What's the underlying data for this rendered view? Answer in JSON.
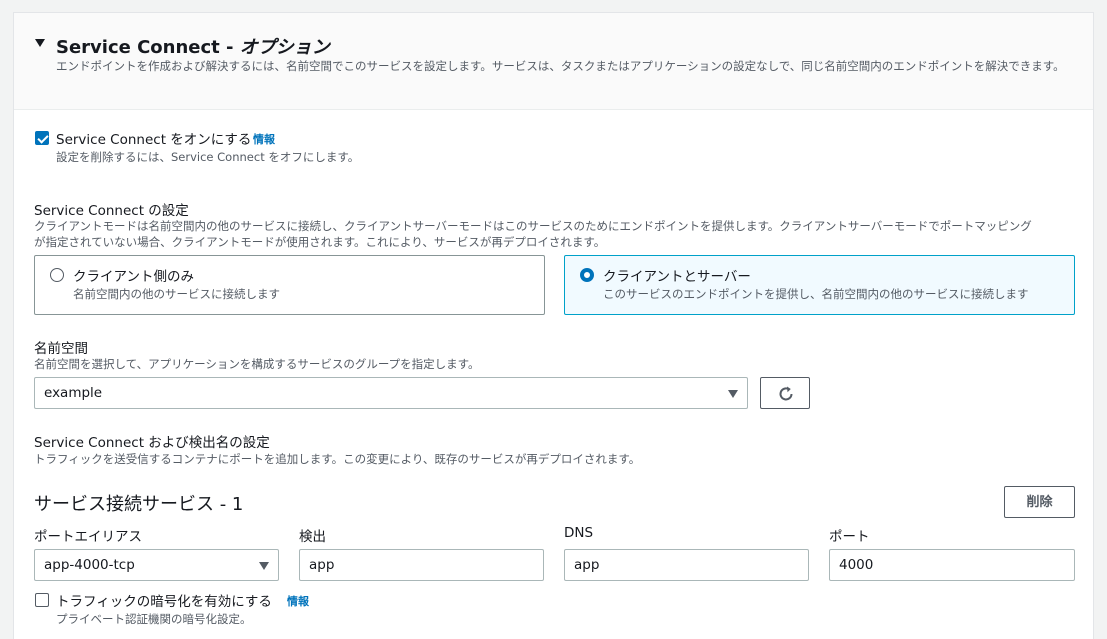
{
  "header": {
    "title_main": "Service Connect - ",
    "title_option": "オプション",
    "description": "エンドポイントを作成および解決するには、名前空間でこのサービスを設定します。サービスは、タスクまたはアプリケーションの設定なしで、同じ名前空間内のエンドポイントを解決できます。"
  },
  "enable": {
    "label": "Service Connect をオンにする",
    "info": "情報",
    "description": "設定を削除するには、Service Connect をオフにします。",
    "checked": true
  },
  "config": {
    "label": "Service Connect の設定",
    "description_line1": "クライアントモードは名前空間内の他のサービスに接続し、クライアントサーバーモードはこのサービスのためにエンドポイントを提供します。クライアントサーバーモードでポートマッピング",
    "description_line2": "が指定されていない場合、クライアントモードが使用されます。これにより、サービスが再デプロイされます。",
    "options": [
      {
        "label": "クライアント側のみ",
        "description": "名前空間内の他のサービスに接続します",
        "selected": false
      },
      {
        "label": "クライアントとサーバー",
        "description": "このサービスのエンドポイントを提供し、名前空間内の他のサービスに接続します",
        "selected": true
      }
    ]
  },
  "namespace": {
    "label": "名前空間",
    "description": "名前空間を選択して、アプリケーションを構成するサービスのグループを指定します。",
    "value": "example"
  },
  "discovery": {
    "label": "Service Connect および検出名の設定",
    "description": "トラフィックを送受信するコンテナにポートを追加します。この変更により、既存のサービスが再デプロイされます。"
  },
  "service": {
    "title": "サービス接続サービス - 1",
    "remove_label": "削除",
    "fields": {
      "port_alias": {
        "label": "ポートエイリアス",
        "value": "app-4000-tcp"
      },
      "discovery": {
        "label": "検出",
        "value": "app"
      },
      "dns": {
        "label": "DNS",
        "value": "app"
      },
      "port": {
        "label": "ポート",
        "value": "4000"
      }
    },
    "encryption": {
      "label": "トラフィックの暗号化を有効にする",
      "info": "情報",
      "description": "プライベート認証機関の暗号化設定。",
      "checked": false
    }
  }
}
